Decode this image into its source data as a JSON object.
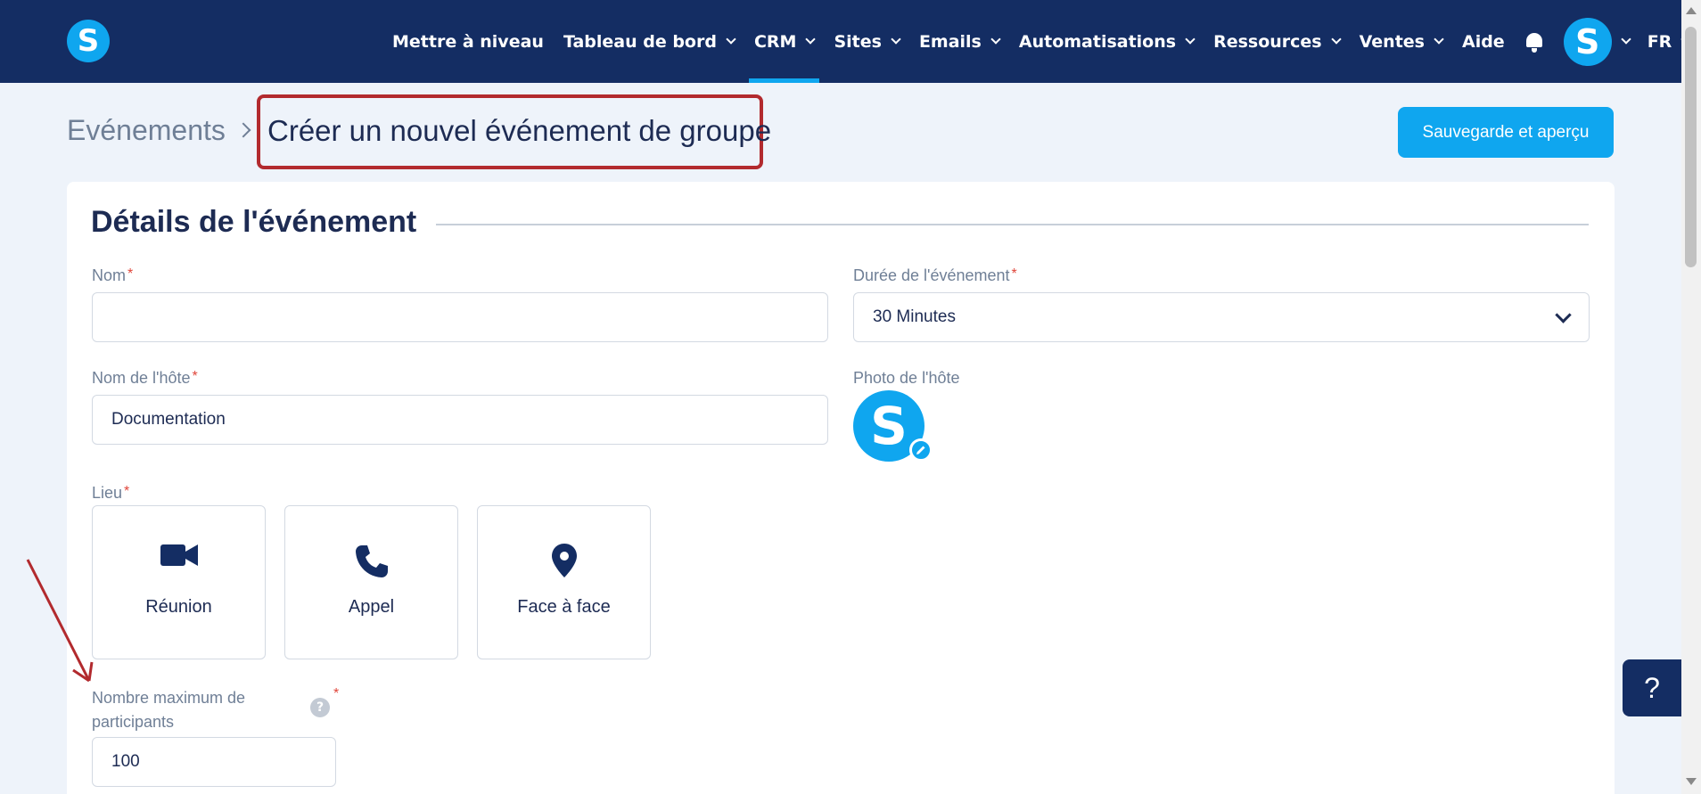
{
  "nav": {
    "logo_letter": "S",
    "items": [
      {
        "label": "Mettre à niveau",
        "dropdown": false,
        "active": false
      },
      {
        "label": "Tableau de bord",
        "dropdown": true,
        "active": false
      },
      {
        "label": "CRM",
        "dropdown": true,
        "active": true
      },
      {
        "label": "Sites",
        "dropdown": true,
        "active": false
      },
      {
        "label": "Emails",
        "dropdown": true,
        "active": false
      },
      {
        "label": "Automatisations",
        "dropdown": true,
        "active": false
      },
      {
        "label": "Ressources",
        "dropdown": true,
        "active": false
      },
      {
        "label": "Ventes",
        "dropdown": true,
        "active": false
      },
      {
        "label": "Aide",
        "dropdown": false,
        "active": false
      }
    ],
    "avatar_letter": "S",
    "language": "FR"
  },
  "breadcrumb": {
    "root": "Evénements",
    "current": "Créer un nouvel événement de groupe"
  },
  "actions": {
    "save_preview": "Sauvegarde et aperçu"
  },
  "details": {
    "title": "Détails de l'événement",
    "name_label": "Nom",
    "name_value": "",
    "duration_label": "Durée de l'événement",
    "duration_value": "30 Minutes",
    "host_name_label": "Nom de l'hôte",
    "host_name_value": "Documentation",
    "host_photo_label": "Photo de l'hôte",
    "host_photo_letter": "S",
    "location_label": "Lieu",
    "locations": [
      {
        "label": "Réunion",
        "icon": "video-camera-icon"
      },
      {
        "label": "Appel",
        "icon": "phone-icon"
      },
      {
        "label": "Face à face",
        "icon": "map-pin-icon"
      }
    ],
    "max_participants_label_1": "Nombre maximum de",
    "max_participants_label_2": "participants",
    "max_participants_value": "100",
    "required_mark": "*",
    "info_mark": "?"
  },
  "help": {
    "label": "?"
  },
  "colors": {
    "nav_bg": "#142d63",
    "accent": "#0fa6ef",
    "highlight_box": "#b22a2e",
    "required": "#e0453a"
  }
}
